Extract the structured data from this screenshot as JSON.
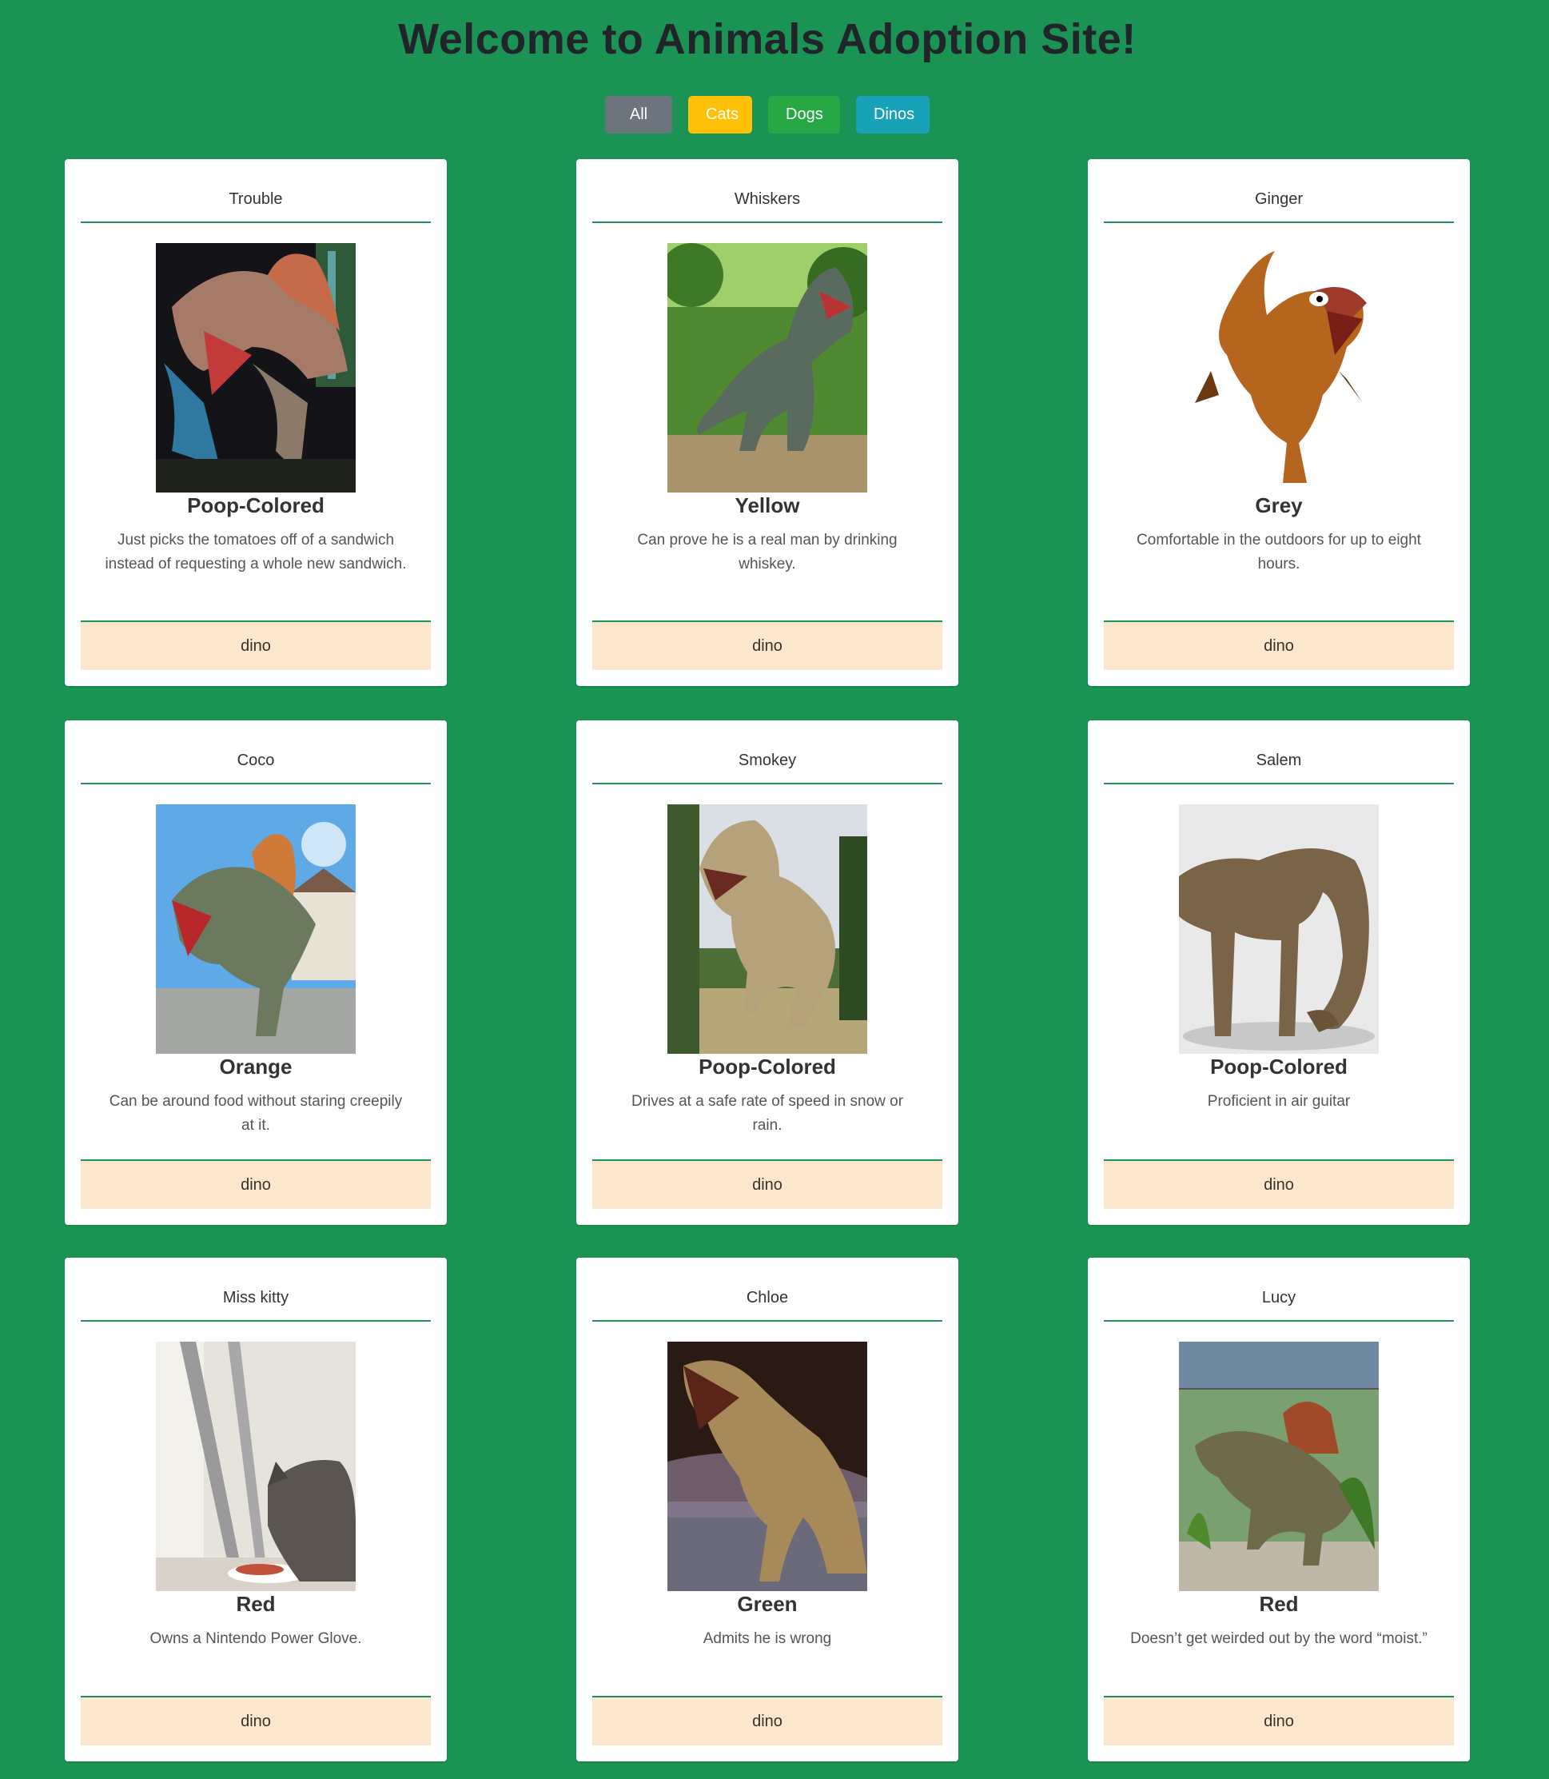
{
  "header": {
    "title": "Welcome to Animals Adoption Site!"
  },
  "filters": {
    "all": "All",
    "cats": "Cats",
    "dogs": "Dogs",
    "dinos": "Dinos"
  },
  "cards": [
    {
      "name": "Trouble",
      "color": "Poop-Colored",
      "description": "Just picks the tomatoes off of a sandwich instead of requesting a whole new sandwich.",
      "type": "dino",
      "image": "spinosaurus-photo"
    },
    {
      "name": "Whiskers",
      "color": "Yellow",
      "description": "Can prove he is a real man by drinking whiskey.",
      "type": "dino",
      "image": "t-rex-forest-photo"
    },
    {
      "name": "Ginger",
      "color": "Grey",
      "description": "Comfortable in the outdoors for up to eight hours.",
      "type": "dino",
      "image": "cartoon-t-rex"
    },
    {
      "name": "Coco",
      "color": "Orange",
      "description": "Can be around food without staring creepily at it.",
      "type": "dino",
      "image": "spinosaurus-model-photo"
    },
    {
      "name": "Smokey",
      "color": "Poop-Colored",
      "description": "Drives at a safe rate of speed in snow or rain.",
      "type": "dino",
      "image": "t-rex-field-photo"
    },
    {
      "name": "Salem",
      "color": "Poop-Colored",
      "description": "Proficient in air guitar",
      "type": "dino",
      "image": "sauropod-render"
    },
    {
      "name": "Miss kitty",
      "color": "Red",
      "description": "Owns a Nintendo Power Glove.",
      "type": "dino",
      "image": "cat-eating-photo"
    },
    {
      "name": "Chloe",
      "color": "Green",
      "description": "Admits he is wrong",
      "type": "dino",
      "image": "t-rex-museum-photo"
    },
    {
      "name": "Lucy",
      "color": "Red",
      "description": "Doesn’t get weirded out by the word “moist.”",
      "type": "dino",
      "image": "spinosaurus-exhibit-photo"
    }
  ],
  "colors": {
    "background": "#1a9355",
    "footer": "#fde7cc",
    "all": "#6c757d",
    "cats": "#ffc107",
    "dogs": "#28a745",
    "dinos": "#17a2b8"
  }
}
